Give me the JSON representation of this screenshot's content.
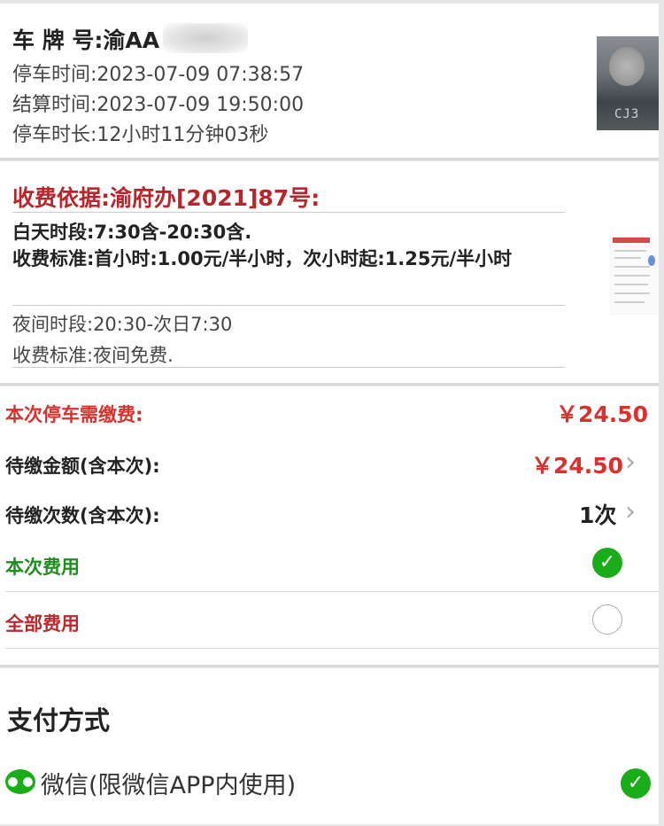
{
  "vehicle": {
    "plate_label": "车 牌 号:",
    "plate_value": "渝AA",
    "park_time": "停车时间:2023-07-09 07:38:57",
    "settle_time": "结算时间:2023-07-09 19:50:00",
    "duration": "停车时长:12小时11分钟03秒"
  },
  "basis": {
    "title": "收费依据:渝府办[2021]87号:",
    "day_period": "白天时段:7:30含-20:30含.",
    "day_standard": "收费标准:首小时:1.00元/半小时，次小时起:1.25元/半小时",
    "night_period": "夜间时段:20:30-次日7:30",
    "night_standard": "收费标准:夜间免费."
  },
  "fee": {
    "current_label": "本次停车需缴费:",
    "current_value": "￥24.50",
    "pending_amount_label": "待缴金额(含本次):",
    "pending_amount_value": "￥24.50",
    "pending_count_label": "待缴次数(含本次):",
    "pending_count_value": "1次",
    "option_this_label": "本次费用",
    "option_all_label": "全部费用"
  },
  "payment": {
    "title": "支付方式",
    "wechat_label": "微信(限微信APP内使用)"
  },
  "colors": {
    "accent_red": "#d9312d",
    "title_crimson": "#b8262c",
    "check_green": "#1aad19",
    "label_green": "#1e8f1e"
  },
  "icons": {
    "chevron": "chevron-right-icon",
    "check": "checkmark-circle-icon",
    "radio": "radio-empty-icon",
    "wechat": "wechat-icon"
  }
}
